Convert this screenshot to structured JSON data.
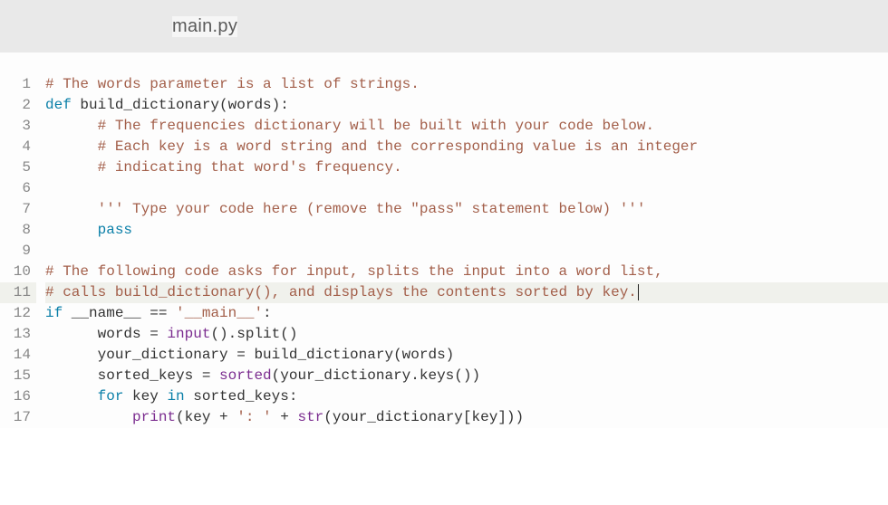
{
  "header": {
    "filename": "main.py"
  },
  "editor": {
    "line_count": 17,
    "highlighted_line": 11,
    "code": {
      "l1": {
        "cm": "# The words parameter is a list of strings."
      },
      "l2": {
        "kw": "def ",
        "ident": "build_dictionary(words):"
      },
      "l3": {
        "indent": "      ",
        "cm": "# The frequencies dictionary will be built with your code below."
      },
      "l4": {
        "indent": "      ",
        "cm": "# Each key is a word string and the corresponding value is an integer"
      },
      "l5": {
        "indent": "      ",
        "cm": "# indicating that word's frequency."
      },
      "l6": {
        "blank": ""
      },
      "l7": {
        "indent": "      ",
        "str": "''' Type your code here (remove the \"pass\" statement below) '''"
      },
      "l8": {
        "indent": "      ",
        "kw": "pass"
      },
      "l9": {
        "blank": ""
      },
      "l10": {
        "cm": "# The following code asks for input, splits the input into a word list,"
      },
      "l11": {
        "cm": "# calls build_dictionary(), and displays the contents sorted by key."
      },
      "l12": {
        "kw1": "if",
        "a": " __name__ == ",
        "str": "'__main__'",
        "b": ":"
      },
      "l13": {
        "indent": "      ",
        "a": "words = ",
        "bi": "input",
        "b": "().split()"
      },
      "l14": {
        "indent": "      ",
        "a": "your_dictionary = build_dictionary(words)"
      },
      "l15": {
        "indent": "      ",
        "a": "sorted_keys = ",
        "bi": "sorted",
        "b": "(your_dictionary.keys())"
      },
      "l16": {
        "indent": "      ",
        "kw1": "for",
        "a": " key ",
        "kw2": "in",
        "b": " sorted_keys:"
      },
      "l17": {
        "indent": "          ",
        "bi": "print",
        "a": "(key + ",
        "str1": "': '",
        "b": " + ",
        "bi2": "str",
        "c": "(your_dictionary[key]))"
      }
    }
  }
}
